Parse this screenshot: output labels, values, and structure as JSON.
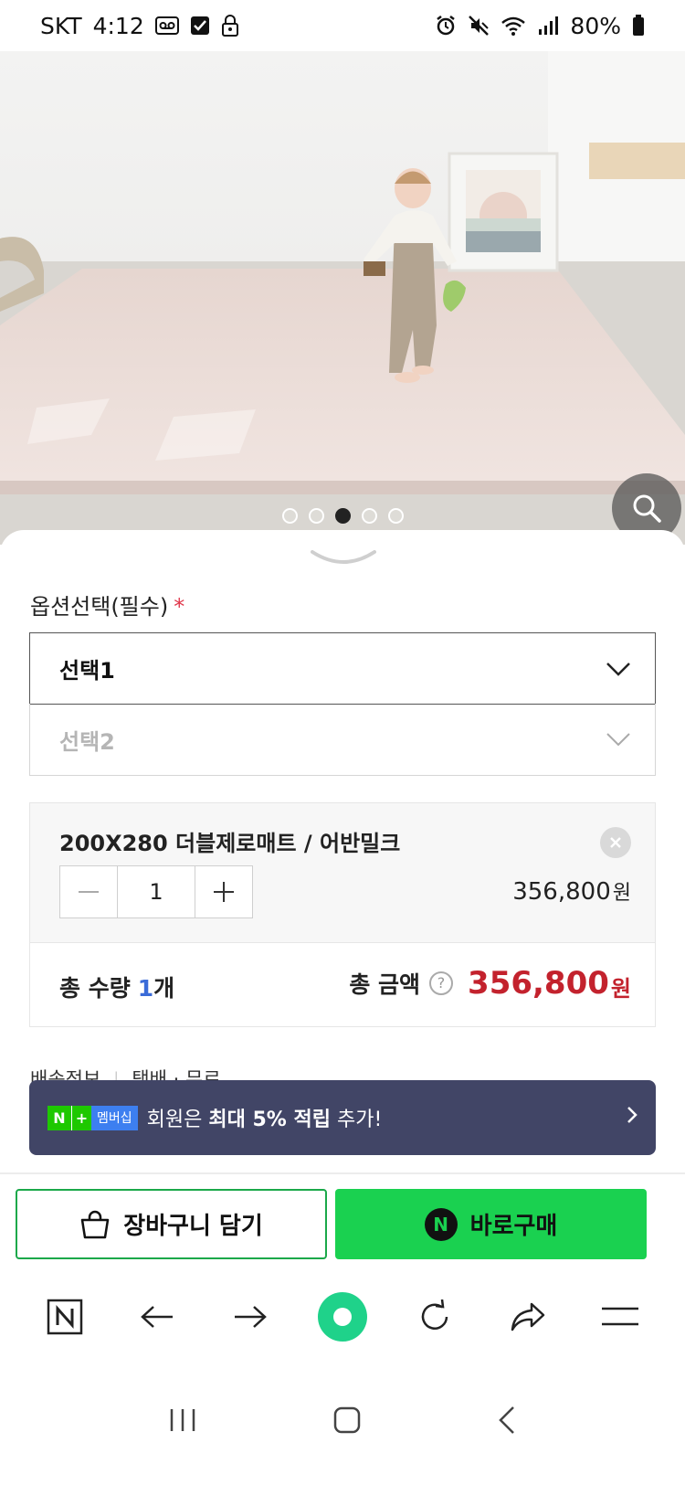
{
  "status_bar": {
    "carrier": "SKT",
    "time": "4:12",
    "battery": "80%"
  },
  "gallery": {
    "slide_count": 5,
    "active_index": 2
  },
  "options": {
    "title": "옵션선택(필수)",
    "required_mark": "*",
    "select1_label": "선택1",
    "select2_label": "선택2"
  },
  "selected_item": {
    "name": "200X280 더블제로매트 / 어반밀크",
    "quantity": "1",
    "price": "356,800",
    "price_unit": "원"
  },
  "total": {
    "qty_label": "총 수량",
    "qty_value": "1",
    "qty_unit": "개",
    "amount_label": "총 금액",
    "amount_value": "356,800",
    "amount_unit": "원"
  },
  "shipping": {
    "label": "배송정보",
    "value": "택배 · 무료"
  },
  "banner": {
    "badge_n": "N",
    "badge_plus": "+",
    "badge_membership": "멤버십",
    "text_prefix": "회원은 ",
    "text_bold": "최대 5% 적립",
    "text_suffix": " 추가!"
  },
  "actions": {
    "cart_label": "장바구니 담기",
    "buy_label": "바로구매",
    "buy_icon_letter": "N"
  },
  "browser": {
    "home_letter": "N"
  },
  "colors": {
    "buy_green": "#1ad150",
    "cart_border": "#1ba84a",
    "price_red": "#c3222d",
    "banner_bg": "#414566"
  }
}
